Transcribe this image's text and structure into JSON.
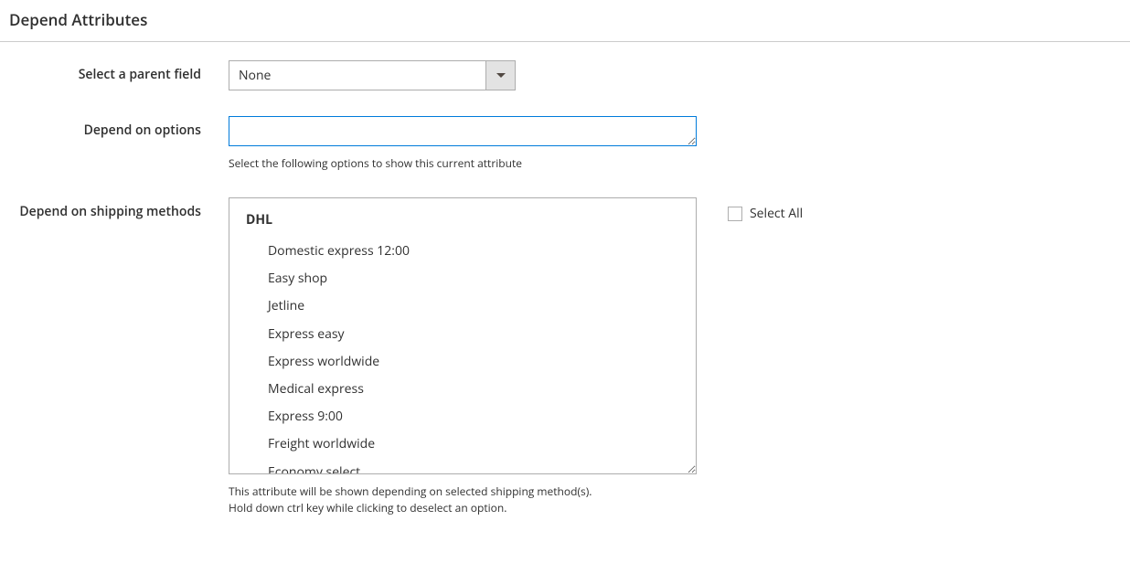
{
  "section": {
    "title": "Depend Attributes"
  },
  "fields": {
    "parent": {
      "label": "Select a parent field",
      "value": "None"
    },
    "depend_options": {
      "label": "Depend on options",
      "value": "",
      "help": "Select the following options to show this current attribute"
    },
    "shipping_methods": {
      "label": "Depend on shipping methods",
      "group": "DHL",
      "options": [
        "Domestic express 12:00",
        "Easy shop",
        "Jetline",
        "Express easy",
        "Express worldwide",
        "Medical express",
        "Express 9:00",
        "Freight worldwide",
        "Economy select"
      ],
      "help_line1": "This attribute will be shown depending on selected shipping method(s).",
      "help_line2": "Hold down ctrl key while clicking to deselect an option.",
      "select_all": "Select All"
    }
  }
}
